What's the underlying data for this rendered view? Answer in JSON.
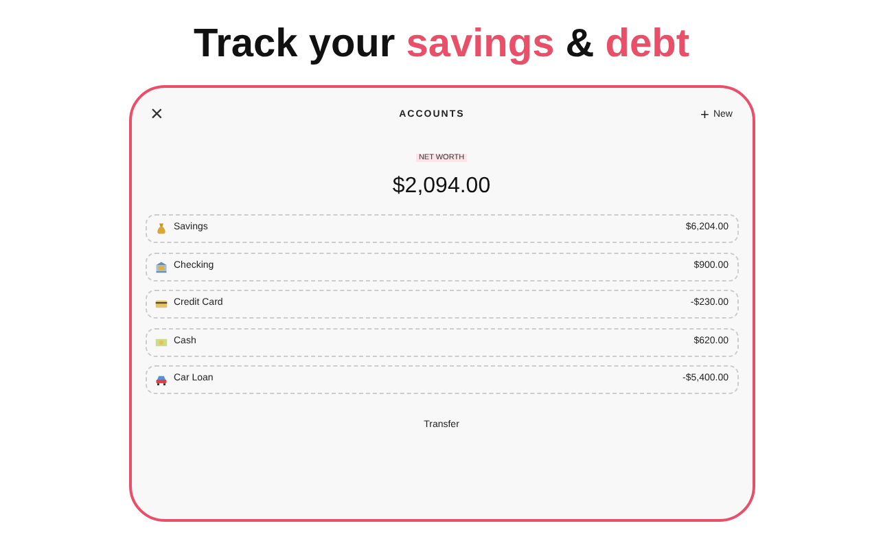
{
  "headline": [
    {
      "text": "Track your ",
      "kind": "plain"
    },
    {
      "text": "savings",
      "kind": "accent"
    },
    {
      "text": " & ",
      "kind": "plain"
    },
    {
      "text": "debt",
      "kind": "accent"
    }
  ],
  "header": {
    "close": "×",
    "title": "ACCOUNTS",
    "new_icon": "+",
    "new_label": "New"
  },
  "net_worth": {
    "label": "NET WORTH",
    "amount": "$2,094.00"
  },
  "accounts": [
    {
      "kind": "moneybag",
      "name": "Savings",
      "amount": "$6,204.00"
    },
    {
      "kind": "bank",
      "name": "Checking",
      "amount": "$900.00"
    },
    {
      "kind": "card",
      "name": "Credit Card",
      "amount": "-$230.00"
    },
    {
      "kind": "cash",
      "name": "Cash",
      "amount": "$620.00"
    },
    {
      "kind": "car",
      "name": "Car Loan",
      "amount": "-$5,400.00"
    }
  ],
  "transfer": "Transfer"
}
